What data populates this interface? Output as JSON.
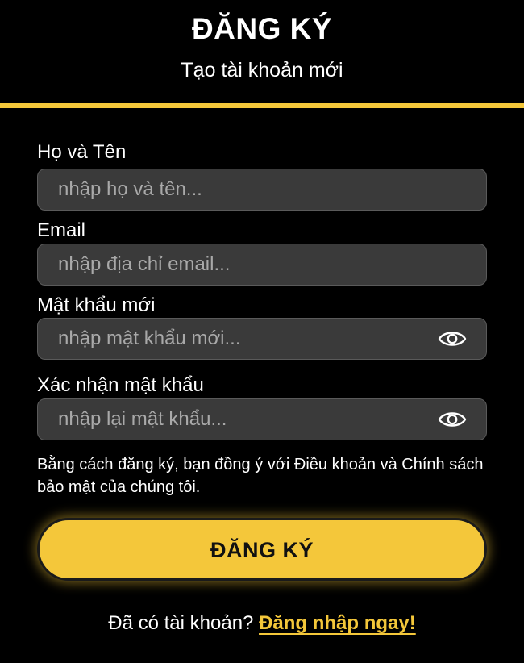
{
  "header": {
    "title": "ĐĂNG KÝ",
    "subtitle": "Tạo tài khoản mới"
  },
  "form": {
    "full_name": {
      "label": "Họ và Tên",
      "placeholder": "nhập họ và tên..."
    },
    "email": {
      "label": "Email",
      "placeholder": "nhập địa chỉ email..."
    },
    "new_password": {
      "label": "Mật khẩu mới",
      "placeholder": "nhập mật khẩu mới...",
      "toggle_icon": "eye-icon"
    },
    "confirm_password": {
      "label": "Xác nhận mật khẩu",
      "placeholder": "nhập lại mật khẩu...",
      "toggle_icon": "eye-icon"
    },
    "terms_text": "Bằng cách đăng ký, bạn đồng ý với Điều khoản và Chính sách bảo mật của chúng tôi.",
    "submit_label": "ĐĂNG KÝ"
  },
  "footer": {
    "prompt": "Đã có tài khoản? ",
    "login_link": "Đăng nhập ngay!"
  },
  "colors": {
    "background": "#000000",
    "accent": "#F4C73A",
    "field_background": "#3A3A3A",
    "placeholder": "#A9A9A9"
  }
}
